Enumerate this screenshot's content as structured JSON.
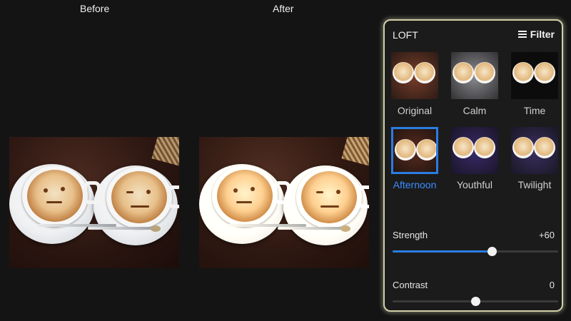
{
  "labels": {
    "before": "Before",
    "after": "After"
  },
  "panel": {
    "title": "LOFT",
    "filter_button": "Filter",
    "filters": [
      {
        "label": "Original",
        "selected": false,
        "tint": "#7a3e2a"
      },
      {
        "label": "Calm",
        "selected": false,
        "tint": "#8c8c92"
      },
      {
        "label": "Time",
        "selected": false,
        "tint": "#0c0c0c"
      },
      {
        "label": "Afternoon",
        "selected": true,
        "tint": "#5a2b1e"
      },
      {
        "label": "Youthful",
        "selected": false,
        "tint": "#3a2a6a"
      },
      {
        "label": "Twilight",
        "selected": false,
        "tint": "#3a3060"
      }
    ],
    "strength": {
      "label": "Strength",
      "value": "+60",
      "fraction": 0.6
    },
    "contrast": {
      "label": "Contrast",
      "value": "0",
      "fraction": 0.5
    }
  },
  "colors": {
    "accent": "#2a7de1",
    "panel_border": "#cfcfa8"
  }
}
